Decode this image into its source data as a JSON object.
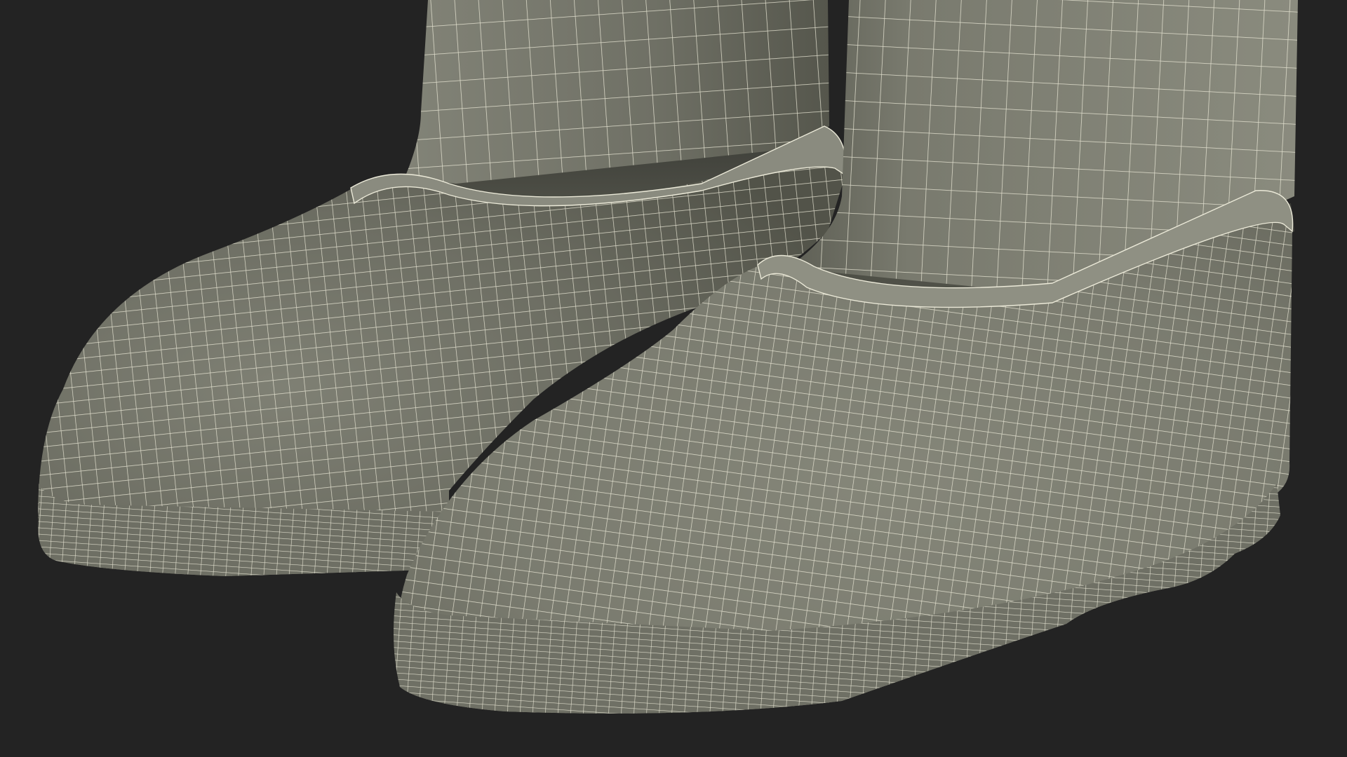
{
  "scene": {
    "background_color": "#232323",
    "mesh_fill_color": "#7b7c70",
    "mesh_shadow_color": "#55564c",
    "mesh_highlight_color": "#8c8d80",
    "wireframe_color": "#e9e7d6",
    "objects": [
      {
        "name": "left-boot",
        "role": "3D wireframe model of a boot"
      },
      {
        "name": "right-boot",
        "role": "3D wireframe model of a boot"
      }
    ]
  }
}
